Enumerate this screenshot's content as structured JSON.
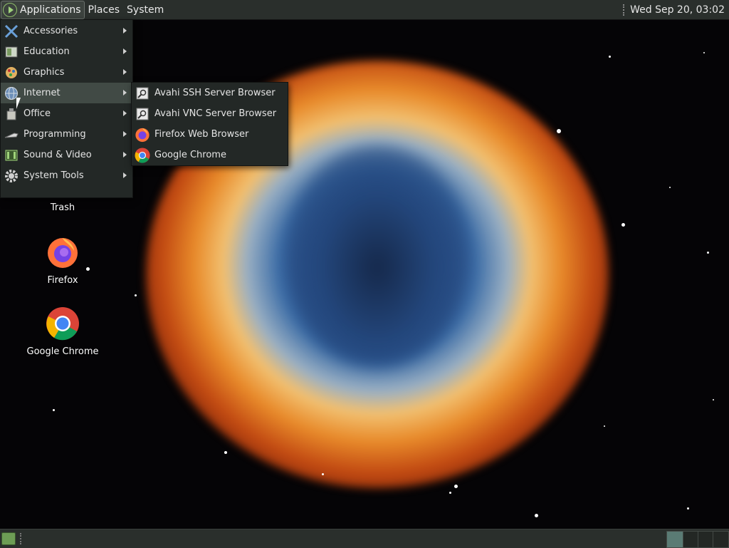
{
  "top_panel": {
    "applications_label": "Applications",
    "places_label": "Places",
    "system_label": "System",
    "clock": "Wed Sep 20, 03:02"
  },
  "applications_menu": {
    "items": [
      {
        "label": "Accessories",
        "icon": "accessories-icon"
      },
      {
        "label": "Education",
        "icon": "education-icon"
      },
      {
        "label": "Graphics",
        "icon": "graphics-icon"
      },
      {
        "label": "Internet",
        "icon": "internet-globe-icon"
      },
      {
        "label": "Office",
        "icon": "office-icon"
      },
      {
        "label": "Programming",
        "icon": "programming-icon"
      },
      {
        "label": "Sound & Video",
        "icon": "sound-video-icon"
      },
      {
        "label": "System Tools",
        "icon": "system-tools-gear-icon"
      }
    ]
  },
  "internet_submenu": {
    "items": [
      {
        "label": "Avahi SSH Server Browser",
        "icon": "avahi-browser-icon"
      },
      {
        "label": "Avahi VNC Server Browser",
        "icon": "avahi-browser-icon"
      },
      {
        "label": "Firefox Web Browser",
        "icon": "firefox-icon"
      },
      {
        "label": "Google Chrome",
        "icon": "chrome-icon"
      }
    ]
  },
  "desktop_icons": {
    "trash": "Trash",
    "firefox": "Firefox",
    "chrome": "Google Chrome"
  },
  "colors": {
    "panel": "#2a2f2c",
    "menu_bg": "#232826",
    "menu_hover": "#414a45",
    "accent_green": "#9fd37a"
  }
}
